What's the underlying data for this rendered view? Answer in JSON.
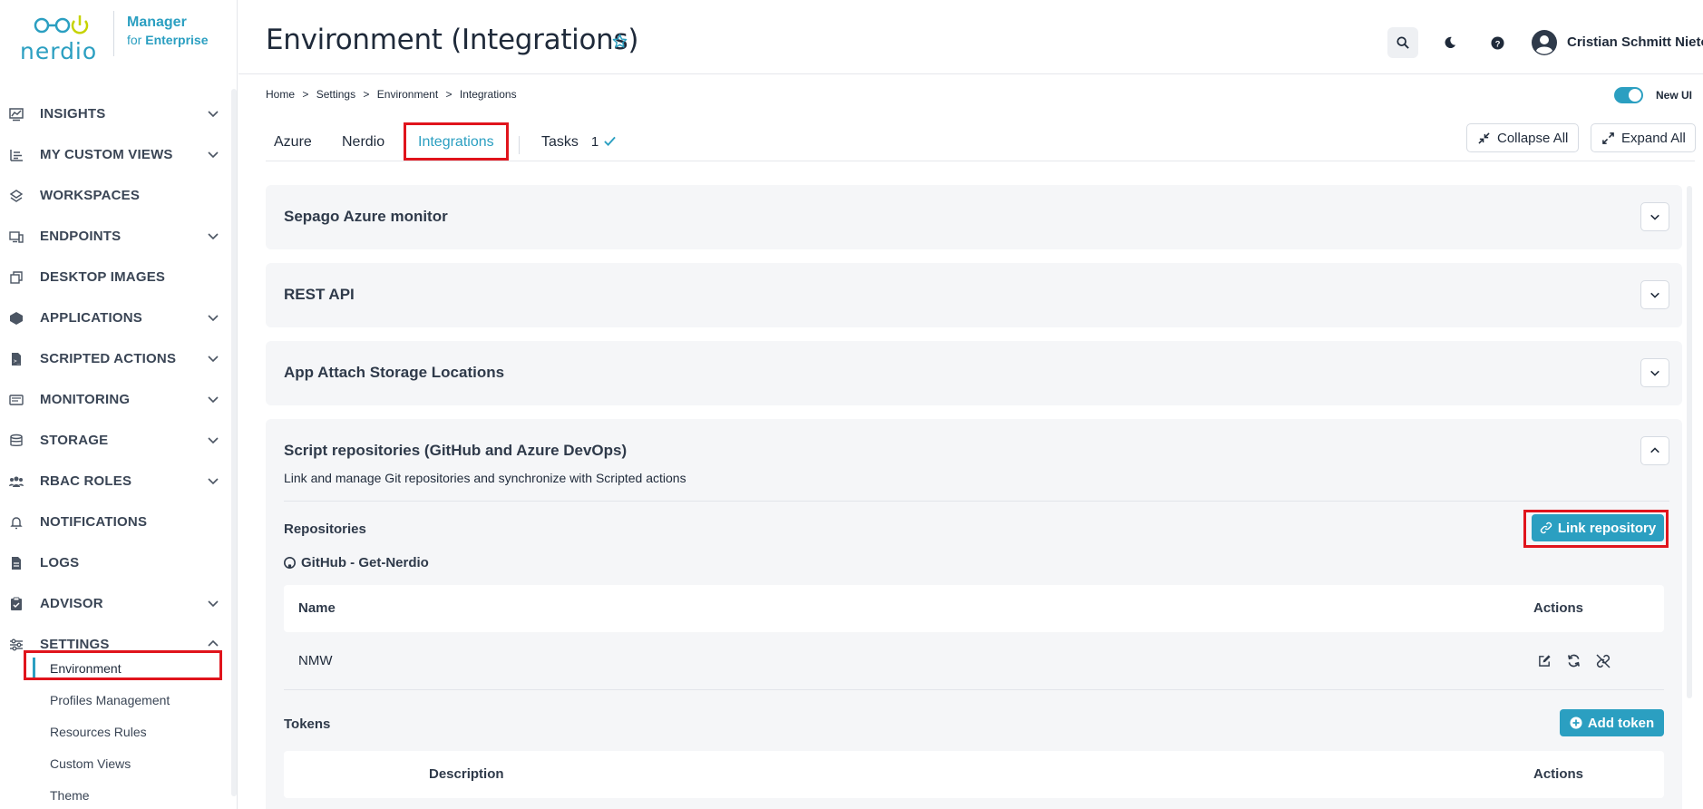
{
  "brand": {
    "name": "nerdio",
    "product_line1": "Manager",
    "product_line2_prefix": "for",
    "product_line2": "Enterprise"
  },
  "header": {
    "title": "Environment (Integrations)",
    "user_name": "Cristian Schmitt Nieto"
  },
  "sidebar": {
    "items": [
      {
        "label": "INSIGHTS",
        "icon": "insights-icon",
        "expandable": true
      },
      {
        "label": "MY CUSTOM VIEWS",
        "icon": "custom-views-icon",
        "expandable": true
      },
      {
        "label": "WORKSPACES",
        "icon": "workspaces-icon",
        "expandable": false
      },
      {
        "label": "ENDPOINTS",
        "icon": "endpoints-icon",
        "expandable": true
      },
      {
        "label": "DESKTOP IMAGES",
        "icon": "desktop-images-icon",
        "expandable": false
      },
      {
        "label": "APPLICATIONS",
        "icon": "applications-icon",
        "expandable": true
      },
      {
        "label": "SCRIPTED ACTIONS",
        "icon": "scripted-actions-icon",
        "expandable": true
      },
      {
        "label": "MONITORING",
        "icon": "monitoring-icon",
        "expandable": true
      },
      {
        "label": "STORAGE",
        "icon": "storage-icon",
        "expandable": true
      },
      {
        "label": "RBAC ROLES",
        "icon": "rbac-icon",
        "expandable": true
      },
      {
        "label": "NOTIFICATIONS",
        "icon": "bell-icon",
        "expandable": false
      },
      {
        "label": "LOGS",
        "icon": "logs-icon",
        "expandable": false
      },
      {
        "label": "ADVISOR",
        "icon": "advisor-icon",
        "expandable": true
      },
      {
        "label": "SETTINGS",
        "icon": "settings-icon",
        "expandable": true,
        "expanded": true
      }
    ],
    "settings_subitems": [
      {
        "label": "Environment",
        "active": true
      },
      {
        "label": "Profiles Management"
      },
      {
        "label": "Resources Rules"
      },
      {
        "label": "Custom Views"
      },
      {
        "label": "Theme"
      }
    ]
  },
  "breadcrumb": [
    "Home",
    ">",
    "Settings",
    ">",
    "Environment",
    ">",
    "Integrations"
  ],
  "toggle": {
    "label": "New UI",
    "on": true
  },
  "tabs": [
    {
      "label": "Azure"
    },
    {
      "label": "Nerdio"
    },
    {
      "label": "Integrations",
      "active": true
    },
    {
      "label": "Tasks",
      "count": "1"
    }
  ],
  "toolbar": {
    "collapse_all": "Collapse All",
    "expand_all": "Expand All"
  },
  "panels": {
    "p1": {
      "title": "Sepago Azure monitor"
    },
    "p2": {
      "title": "REST API"
    },
    "p3": {
      "title": "App Attach Storage Locations"
    },
    "p4": {
      "title": "Script repositories (GitHub and Azure DevOps)",
      "description": "Link and manage Git repositories and synchronize with Scripted actions",
      "repositories_label": "Repositories",
      "link_button": "Link repository",
      "source": "GitHub - Get-Nerdio",
      "repo_table": {
        "headers": [
          "Name",
          "Actions"
        ],
        "rows": [
          {
            "name": "NMW"
          }
        ]
      },
      "tokens_label": "Tokens",
      "add_token_button": "Add token",
      "token_table": {
        "headers": [
          "Description",
          "Actions"
        ]
      }
    }
  },
  "colors": {
    "accent": "#2b9fc1",
    "highlight": "#e0141c"
  }
}
